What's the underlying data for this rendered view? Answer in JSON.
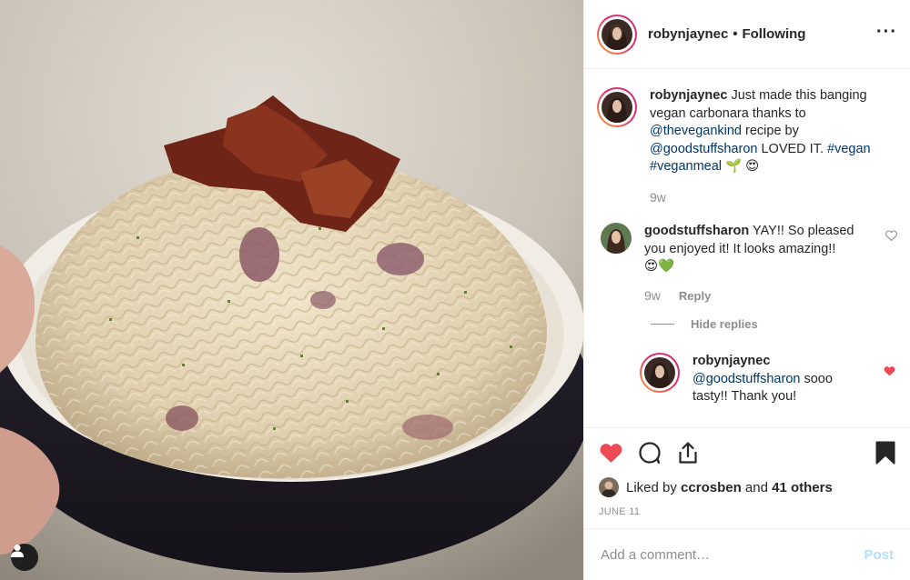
{
  "post": {
    "author": "robynjaynec",
    "follow_status": "Following",
    "more_icon": "···",
    "caption": {
      "username": "robynjaynec",
      "text_1": "Just made this banging vegan carbonara thanks to",
      "mention_1": "@thevegankind",
      "text_2": "recipe by",
      "mention_2": "@goodstuffsharon",
      "text_3": "LOVED IT.",
      "hashtag_1": "#vegan",
      "hashtag_2": "#veganmeal",
      "emoji": "🌱 😍",
      "age": "9w"
    },
    "comments": [
      {
        "username": "goodstuffsharon",
        "text": "YAY!! So pleased you enjoyed it! It looks amazing!!",
        "emoji": "😍💚",
        "age": "9w",
        "reply_label": "Reply",
        "hide_replies_label": "Hide replies",
        "replies": [
          {
            "username": "robynjaynec",
            "mention": "@goodstuffsharon",
            "text": "sooo tasty!! Thank you!",
            "liked": true
          }
        ]
      }
    ],
    "likes": {
      "prefix": "Liked by",
      "user": "ccrosben",
      "joiner": "and",
      "others": "41 others"
    },
    "date": "JUNE 11",
    "add_comment": {
      "placeholder": "Add a comment…",
      "post_label": "Post"
    },
    "colors": {
      "like_red": "#ed4956",
      "link_blue": "#00376b",
      "post_disabled": "#b2dffc",
      "muted": "#8e8e8e"
    }
  }
}
